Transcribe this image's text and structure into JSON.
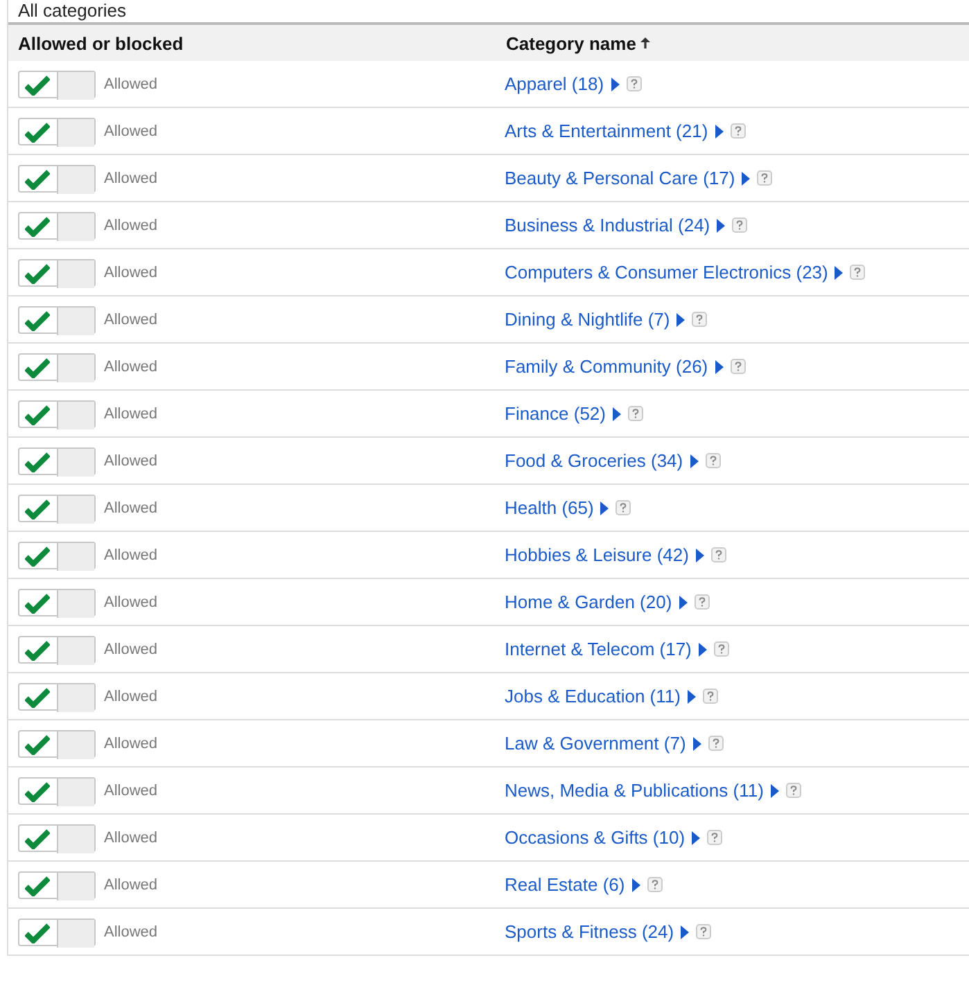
{
  "caption": "All categories",
  "table": {
    "columns": [
      {
        "label": "Allowed or blocked",
        "sorted": false
      },
      {
        "label": "Category name",
        "sorted": true
      }
    ],
    "rows": [
      {
        "allowed": true,
        "status": "Allowed",
        "category": "Apparel (18)"
      },
      {
        "allowed": true,
        "status": "Allowed",
        "category": "Arts & Entertainment (21)"
      },
      {
        "allowed": true,
        "status": "Allowed",
        "category": "Beauty & Personal Care (17)"
      },
      {
        "allowed": true,
        "status": "Allowed",
        "category": "Business & Industrial (24)"
      },
      {
        "allowed": true,
        "status": "Allowed",
        "category": "Computers & Consumer Electronics (23)"
      },
      {
        "allowed": true,
        "status": "Allowed",
        "category": "Dining & Nightlife (7)"
      },
      {
        "allowed": true,
        "status": "Allowed",
        "category": "Family & Community (26)"
      },
      {
        "allowed": true,
        "status": "Allowed",
        "category": "Finance (52)"
      },
      {
        "allowed": true,
        "status": "Allowed",
        "category": "Food & Groceries (34)"
      },
      {
        "allowed": true,
        "status": "Allowed",
        "category": "Health (65)"
      },
      {
        "allowed": true,
        "status": "Allowed",
        "category": "Hobbies & Leisure (42)"
      },
      {
        "allowed": true,
        "status": "Allowed",
        "category": "Home & Garden (20)"
      },
      {
        "allowed": true,
        "status": "Allowed",
        "category": "Internet & Telecom (17)"
      },
      {
        "allowed": true,
        "status": "Allowed",
        "category": "Jobs & Education (11)"
      },
      {
        "allowed": true,
        "status": "Allowed",
        "category": "Law & Government (7)"
      },
      {
        "allowed": true,
        "status": "Allowed",
        "category": "News, Media & Publications (11)"
      },
      {
        "allowed": true,
        "status": "Allowed",
        "category": "Occasions & Gifts (10)"
      },
      {
        "allowed": true,
        "status": "Allowed",
        "category": "Real Estate (6)"
      },
      {
        "allowed": true,
        "status": "Allowed",
        "category": "Sports & Fitness (24)"
      }
    ]
  }
}
